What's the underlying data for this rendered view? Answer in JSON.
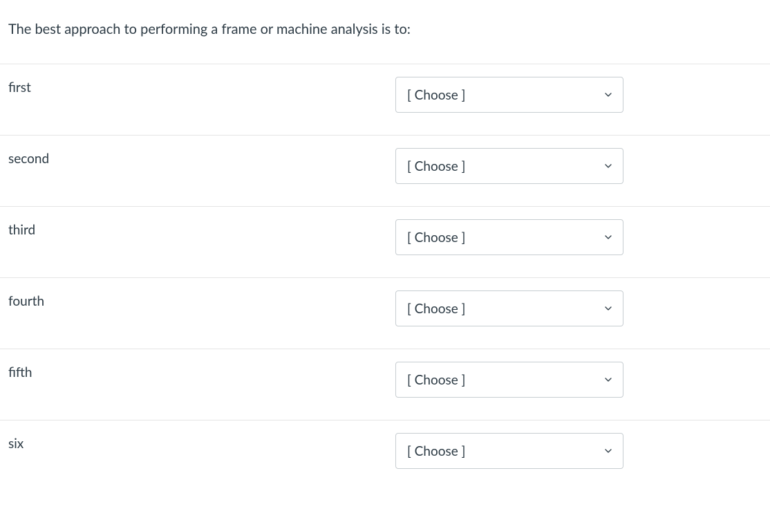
{
  "question": {
    "stem": "The best approach to performing a frame or machine analysis is to:"
  },
  "select_placeholder": "[ Choose ]",
  "rows": [
    {
      "label": "first",
      "selected": "[ Choose ]"
    },
    {
      "label": "second",
      "selected": "[ Choose ]"
    },
    {
      "label": "third",
      "selected": "[ Choose ]"
    },
    {
      "label": "fourth",
      "selected": "[ Choose ]"
    },
    {
      "label": "fifth",
      "selected": "[ Choose ]"
    },
    {
      "label": "six",
      "selected": "[ Choose ]"
    }
  ]
}
